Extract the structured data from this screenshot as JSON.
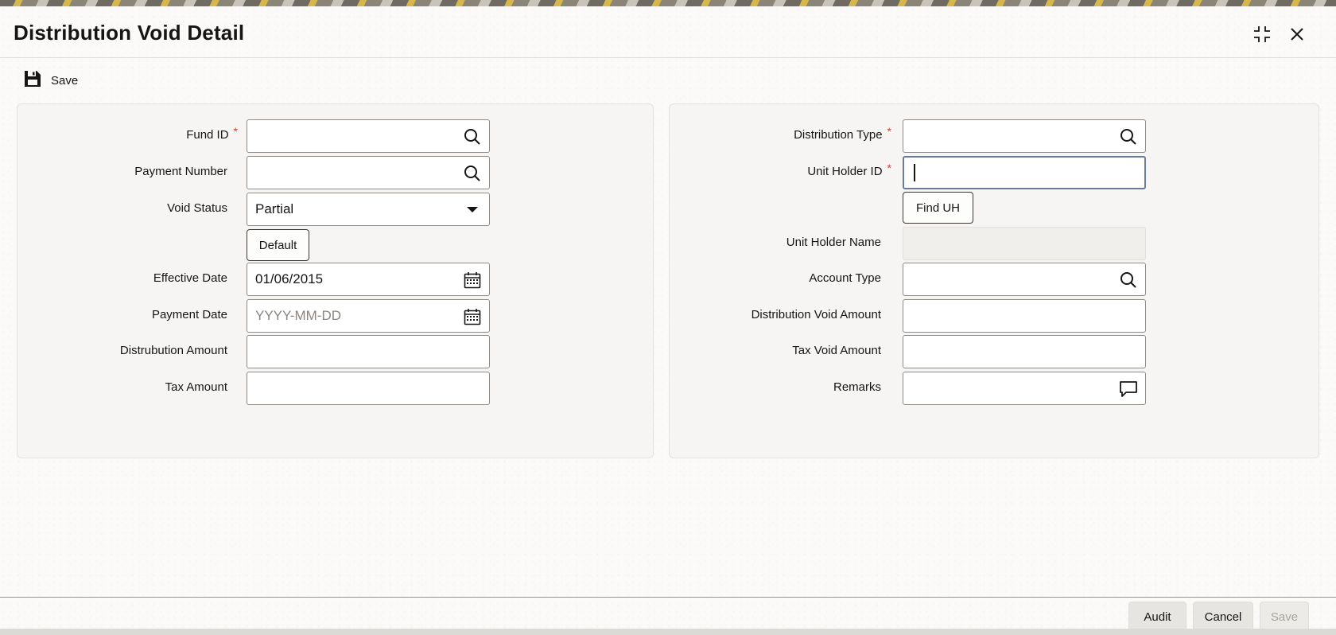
{
  "title": "Distribution Void Detail",
  "toolbar": {
    "save_label": "Save"
  },
  "left_form": {
    "fund_id": {
      "label": "Fund ID",
      "required": "*",
      "value": ""
    },
    "payment_number": {
      "label": "Payment Number",
      "value": ""
    },
    "void_status": {
      "label": "Void Status",
      "value": "Partial"
    },
    "default_button": "Default",
    "effective_date": {
      "label": "Effective Date",
      "value": "01/06/2015"
    },
    "payment_date": {
      "label": "Payment Date",
      "placeholder": "YYYY-MM-DD"
    },
    "distribution_amount": {
      "label": "Distrubution Amount",
      "value": ""
    },
    "tax_amount": {
      "label": "Tax Amount",
      "value": ""
    }
  },
  "right_form": {
    "distribution_type": {
      "label": "Distribution Type",
      "required": "*",
      "value": ""
    },
    "unit_holder_id": {
      "label": "Unit Holder ID",
      "required": "*",
      "value": ""
    },
    "find_uh_button": "Find UH",
    "unit_holder_name": {
      "label": "Unit Holder Name",
      "value": ""
    },
    "account_type": {
      "label": "Account Type",
      "value": ""
    },
    "distribution_void_amount": {
      "label": "Distribution Void Amount",
      "value": ""
    },
    "tax_void_amount": {
      "label": "Tax Void Amount",
      "value": ""
    },
    "remarks": {
      "label": "Remarks",
      "value": ""
    }
  },
  "footer": {
    "audit": "Audit",
    "cancel": "Cancel",
    "save": "Save"
  },
  "colors": {
    "required": "#c74634",
    "focus_border": "#6b7c99",
    "disabled_text": "#a8a49e"
  },
  "icons": [
    "floppy-disk-icon",
    "collapse-icon",
    "close-icon",
    "search-icon",
    "dropdown-arrow-icon",
    "calendar-icon",
    "comment-icon"
  ]
}
